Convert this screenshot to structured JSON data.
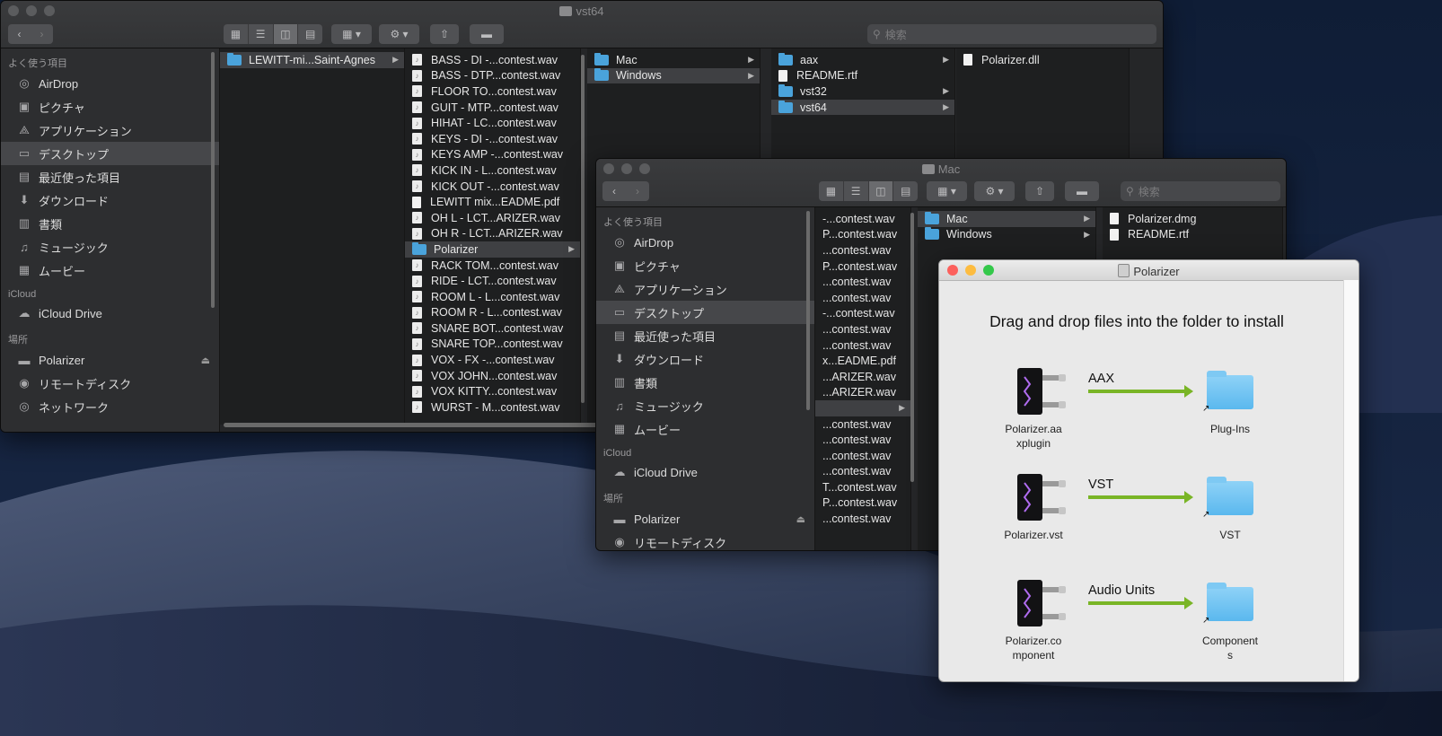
{
  "finder_back": {
    "title": "vst64",
    "search_placeholder": "検索",
    "sidebar": {
      "favorites_header": "よく使う項目",
      "favorites": [
        {
          "label": "AirDrop",
          "icon": "airdrop-icon"
        },
        {
          "label": "ピクチャ",
          "icon": "camera-icon"
        },
        {
          "label": "アプリケーション",
          "icon": "applications-icon"
        },
        {
          "label": "デスクトップ",
          "icon": "desktop-icon",
          "selected": true
        },
        {
          "label": "最近使った項目",
          "icon": "recents-icon"
        },
        {
          "label": "ダウンロード",
          "icon": "downloads-icon"
        },
        {
          "label": "書類",
          "icon": "documents-icon"
        },
        {
          "label": "ミュージック",
          "icon": "music-icon"
        },
        {
          "label": "ムービー",
          "icon": "movies-icon"
        }
      ],
      "icloud_header": "iCloud",
      "icloud": [
        {
          "label": "iCloud Drive",
          "icon": "cloud-icon"
        }
      ],
      "locations_header": "場所",
      "locations": [
        {
          "label": "Polarizer",
          "icon": "disk-icon"
        },
        {
          "label": "リモートディスク",
          "icon": "remote-disk-icon"
        },
        {
          "label": "ネットワーク",
          "icon": "network-icon"
        }
      ]
    },
    "col1": [
      {
        "label": "LEWITT-mi...Saint-Agnes",
        "type": "folder",
        "selected": true
      }
    ],
    "col2": [
      {
        "label": "BASS - DI -...contest.wav",
        "type": "audio"
      },
      {
        "label": "BASS - DTP...contest.wav",
        "type": "audio"
      },
      {
        "label": "FLOOR TO...contest.wav",
        "type": "audio"
      },
      {
        "label": "GUIT - MTP...contest.wav",
        "type": "audio"
      },
      {
        "label": "HIHAT - LC...contest.wav",
        "type": "audio"
      },
      {
        "label": "KEYS - DI -...contest.wav",
        "type": "audio"
      },
      {
        "label": "KEYS AMP -...contest.wav",
        "type": "audio"
      },
      {
        "label": "KICK IN - L...contest.wav",
        "type": "audio"
      },
      {
        "label": "KICK OUT -...contest.wav",
        "type": "audio"
      },
      {
        "label": "LEWITT mix...EADME.pdf",
        "type": "doc"
      },
      {
        "label": "OH L - LCT...ARIZER.wav",
        "type": "audio"
      },
      {
        "label": "OH R - LCT...ARIZER.wav",
        "type": "audio"
      },
      {
        "label": "Polarizer",
        "type": "folder",
        "selected": true
      },
      {
        "label": "RACK TOM...contest.wav",
        "type": "audio"
      },
      {
        "label": "RIDE - LCT...contest.wav",
        "type": "audio"
      },
      {
        "label": "ROOM L - L...contest.wav",
        "type": "audio"
      },
      {
        "label": "ROOM R - L...contest.wav",
        "type": "audio"
      },
      {
        "label": "SNARE BOT...contest.wav",
        "type": "audio"
      },
      {
        "label": "SNARE TOP...contest.wav",
        "type": "audio"
      },
      {
        "label": "VOX - FX -...contest.wav",
        "type": "audio"
      },
      {
        "label": "VOX JOHN...contest.wav",
        "type": "audio"
      },
      {
        "label": "VOX KITTY...contest.wav",
        "type": "audio"
      },
      {
        "label": "WURST - M...contest.wav",
        "type": "audio"
      }
    ],
    "col3": [
      {
        "label": "Mac",
        "type": "folder"
      },
      {
        "label": "Windows",
        "type": "folder",
        "selected": true
      }
    ],
    "col4": [
      {
        "label": "aax",
        "type": "folder"
      },
      {
        "label": "README.rtf",
        "type": "doc"
      },
      {
        "label": "vst32",
        "type": "folder"
      },
      {
        "label": "vst64",
        "type": "folder",
        "selected": true
      }
    ],
    "col5": [
      {
        "label": "Polarizer.dll",
        "type": "doc"
      }
    ]
  },
  "finder_front": {
    "title": "Mac",
    "search_placeholder": "検索",
    "sidebar": {
      "favorites_header": "よく使う項目",
      "favorites": [
        {
          "label": "AirDrop",
          "icon": "airdrop-icon"
        },
        {
          "label": "ピクチャ",
          "icon": "camera-icon"
        },
        {
          "label": "アプリケーション",
          "icon": "applications-icon"
        },
        {
          "label": "デスクトップ",
          "icon": "desktop-icon",
          "selected": true
        },
        {
          "label": "最近使った項目",
          "icon": "recents-icon"
        },
        {
          "label": "ダウンロード",
          "icon": "downloads-icon"
        },
        {
          "label": "書類",
          "icon": "documents-icon"
        },
        {
          "label": "ミュージック",
          "icon": "music-icon"
        },
        {
          "label": "ムービー",
          "icon": "movies-icon"
        }
      ],
      "icloud_header": "iCloud",
      "icloud": [
        {
          "label": "iCloud Drive",
          "icon": "cloud-icon"
        }
      ],
      "locations_header": "場所",
      "locations": [
        {
          "label": "Polarizer",
          "icon": "disk-icon"
        },
        {
          "label": "リモートディスク",
          "icon": "remote-disk-icon"
        }
      ]
    },
    "col2": [
      {
        "label": "-...contest.wav"
      },
      {
        "label": "P...contest.wav"
      },
      {
        "label": "...contest.wav"
      },
      {
        "label": "P...contest.wav"
      },
      {
        "label": "...contest.wav"
      },
      {
        "label": "...contest.wav"
      },
      {
        "label": "-...contest.wav"
      },
      {
        "label": "...contest.wav"
      },
      {
        "label": "...contest.wav"
      },
      {
        "label": "x...EADME.pdf"
      },
      {
        "label": "...ARIZER.wav"
      },
      {
        "label": "...ARIZER.wav"
      },
      {
        "label": "",
        "selected": true
      },
      {
        "label": "...contest.wav"
      },
      {
        "label": "...contest.wav"
      },
      {
        "label": "...contest.wav"
      },
      {
        "label": "...contest.wav"
      },
      {
        "label": "T...contest.wav"
      },
      {
        "label": "P...contest.wav"
      },
      {
        "label": "...contest.wav"
      }
    ],
    "col3": [
      {
        "label": "Mac",
        "type": "folder",
        "selected": true
      },
      {
        "label": "Windows",
        "type": "folder"
      }
    ],
    "col4": [
      {
        "label": "Polarizer.dmg",
        "type": "doc"
      },
      {
        "label": "README.rtf",
        "type": "doc"
      }
    ]
  },
  "installer": {
    "title": "Polarizer",
    "headline": "Drag and drop files into the folder to install",
    "rows": [
      {
        "source": "Polarizer.aa xplugin",
        "arrow_label": "AAX",
        "target": "Plug-Ins"
      },
      {
        "source": "Polarizer.vst",
        "arrow_label": "VST",
        "target": "VST"
      },
      {
        "source": "Polarizer.co mponent",
        "arrow_label": "Audio Units",
        "target": "Component s"
      }
    ]
  },
  "colors": {
    "accent_folder": "#4aa3db",
    "arrow_green": "#79b526",
    "close_red": "#fc605c",
    "min_yellow": "#fdbc40",
    "max_green": "#34c84a"
  }
}
